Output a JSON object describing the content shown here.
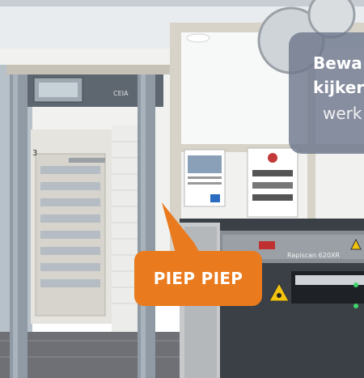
{
  "callout": {
    "text": "PIEP PIEP",
    "color": "#ea7a1e"
  },
  "info_box": {
    "line1": "Bewa",
    "line2": "kijker",
    "line3": "werk"
  },
  "scanner_label": "Rapiscan 620XR",
  "detector_brand": "CEIA",
  "door_number": "3"
}
